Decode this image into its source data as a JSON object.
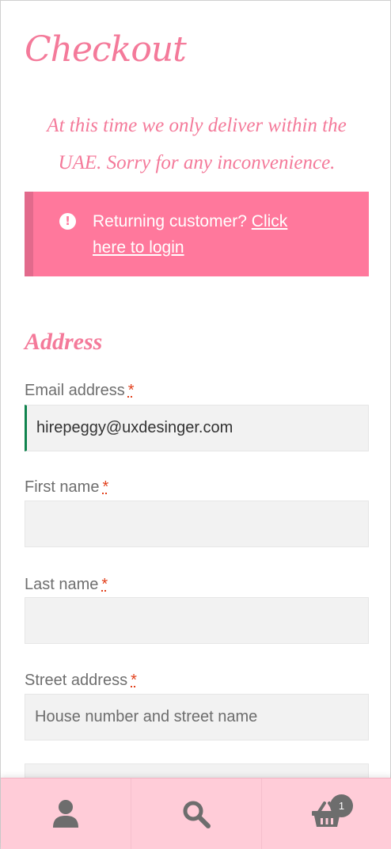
{
  "page": {
    "title": "Checkout"
  },
  "notice": {
    "text": "At this time we only deliver within the UAE. Sorry for any inconvenience."
  },
  "info_box": {
    "prefix": "Returning customer?",
    "link": "Click here to login",
    "icon": "exclamation-icon"
  },
  "section": {
    "title": "Address"
  },
  "form": {
    "required_mark": "*",
    "email": {
      "label": "Email address",
      "value": "hirepeggy@uxdesinger.com"
    },
    "first_name": {
      "label": "First name",
      "value": ""
    },
    "last_name": {
      "label": "Last name",
      "value": ""
    },
    "street": {
      "label": "Street address",
      "placeholder": "House number and street name"
    }
  },
  "bottom_bar": {
    "items": [
      {
        "icon": "account-icon"
      },
      {
        "icon": "search-icon"
      },
      {
        "icon": "cart-icon",
        "count": "1"
      }
    ]
  },
  "colors": {
    "accent": "#f47a9a",
    "info_bg": "#ff789c",
    "bar_bg": "#ffccd8",
    "icon": "#6d6d6d"
  }
}
